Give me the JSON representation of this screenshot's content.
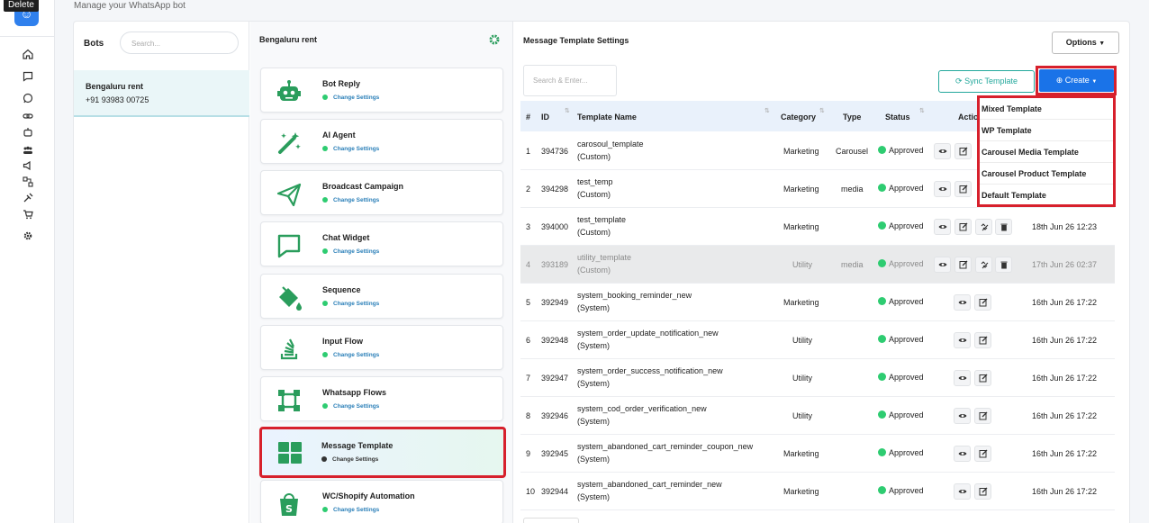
{
  "tooltip": "Delete",
  "header": {
    "subtitle": "Manage your WhatsApp bot"
  },
  "rail": {
    "icons": [
      "home-icon",
      "chat-icon",
      "whatsapp-icon",
      "link-icon",
      "robot-icon",
      "users-icon",
      "megaphone-icon",
      "flows-icon",
      "integration-icon",
      "cart-icon",
      "gear-icon"
    ]
  },
  "bots": {
    "label": "Bots",
    "search_placeholder": "Search...",
    "items": [
      {
        "name": "Bengaluru rent",
        "phone": "+91 93983 00725"
      }
    ]
  },
  "settings": {
    "title": "Bengaluru rent",
    "tiles": [
      {
        "name": "Bot Reply",
        "sub": "Change Settings"
      },
      {
        "name": "AI Agent",
        "sub": "Change Settings"
      },
      {
        "name": "Broadcast Campaign",
        "sub": "Change Settings"
      },
      {
        "name": "Chat Widget",
        "sub": "Change Settings"
      },
      {
        "name": "Sequence",
        "sub": "Change Settings"
      },
      {
        "name": "Input Flow",
        "sub": "Change Settings"
      },
      {
        "name": "Whatsapp Flows",
        "sub": "Change Settings"
      },
      {
        "name": "Message Template",
        "sub": "Change Settings"
      },
      {
        "name": "WC/Shopify Automation",
        "sub": "Change Settings"
      }
    ]
  },
  "templates": {
    "title": "Message Template Settings",
    "options_label": "Options",
    "search_placeholder": "Search & Enter...",
    "sync_label": "Sync Template",
    "create_label": "Create",
    "create_menu": [
      "Mixed Template",
      "WP Template",
      "Carousel Media Template",
      "Carousel Product Template",
      "Default Template"
    ],
    "columns": {
      "num": "#",
      "id": "ID",
      "name": "Template Name",
      "category": "Category",
      "type": "Type",
      "status": "Status",
      "actions": "Actions"
    },
    "rows": [
      {
        "num": "1",
        "id": "394736",
        "name": "carosoul_template",
        "kind": "(Custom)",
        "category": "Marketing",
        "type": "Carousel",
        "status": "Approved",
        "date": ""
      },
      {
        "num": "2",
        "id": "394298",
        "name": "test_temp",
        "kind": "(Custom)",
        "category": "Marketing",
        "type": "media",
        "status": "Approved",
        "date": ""
      },
      {
        "num": "3",
        "id": "394000",
        "name": "test_template",
        "kind": "(Custom)",
        "category": "Marketing",
        "type": "",
        "status": "Approved",
        "date": "18th Jun 26 12:23"
      },
      {
        "num": "4",
        "id": "393189",
        "name": "utility_template",
        "kind": "(Custom)",
        "category": "Utility",
        "type": "media",
        "status": "Approved",
        "date": "17th Jun 26 02:37"
      },
      {
        "num": "5",
        "id": "392949",
        "name": "system_booking_reminder_new",
        "kind": "(System)",
        "category": "Marketing",
        "type": "",
        "status": "Approved",
        "date": "16th Jun 26 17:22"
      },
      {
        "num": "6",
        "id": "392948",
        "name": "system_order_update_notification_new",
        "kind": "(System)",
        "category": "Utility",
        "type": "",
        "status": "Approved",
        "date": "16th Jun 26 17:22"
      },
      {
        "num": "7",
        "id": "392947",
        "name": "system_order_success_notification_new",
        "kind": "(System)",
        "category": "Utility",
        "type": "",
        "status": "Approved",
        "date": "16th Jun 26 17:22"
      },
      {
        "num": "8",
        "id": "392946",
        "name": "system_cod_order_verification_new",
        "kind": "(System)",
        "category": "Utility",
        "type": "",
        "status": "Approved",
        "date": "16th Jun 26 17:22"
      },
      {
        "num": "9",
        "id": "392945",
        "name": "system_abandoned_cart_reminder_coupon_new",
        "kind": "(System)",
        "category": "Marketing",
        "type": "",
        "status": "Approved",
        "date": "16th Jun 26 17:22"
      },
      {
        "num": "10",
        "id": "392944",
        "name": "system_abandoned_cart_reminder_new",
        "kind": "(System)",
        "category": "Marketing",
        "type": "",
        "status": "Approved",
        "date": "16th Jun 26 17:22"
      }
    ]
  },
  "colors": {
    "accent": "#1a73e8",
    "green": "#2a9d5c",
    "highlight": "#d7202c",
    "teal": "#23a89c"
  }
}
